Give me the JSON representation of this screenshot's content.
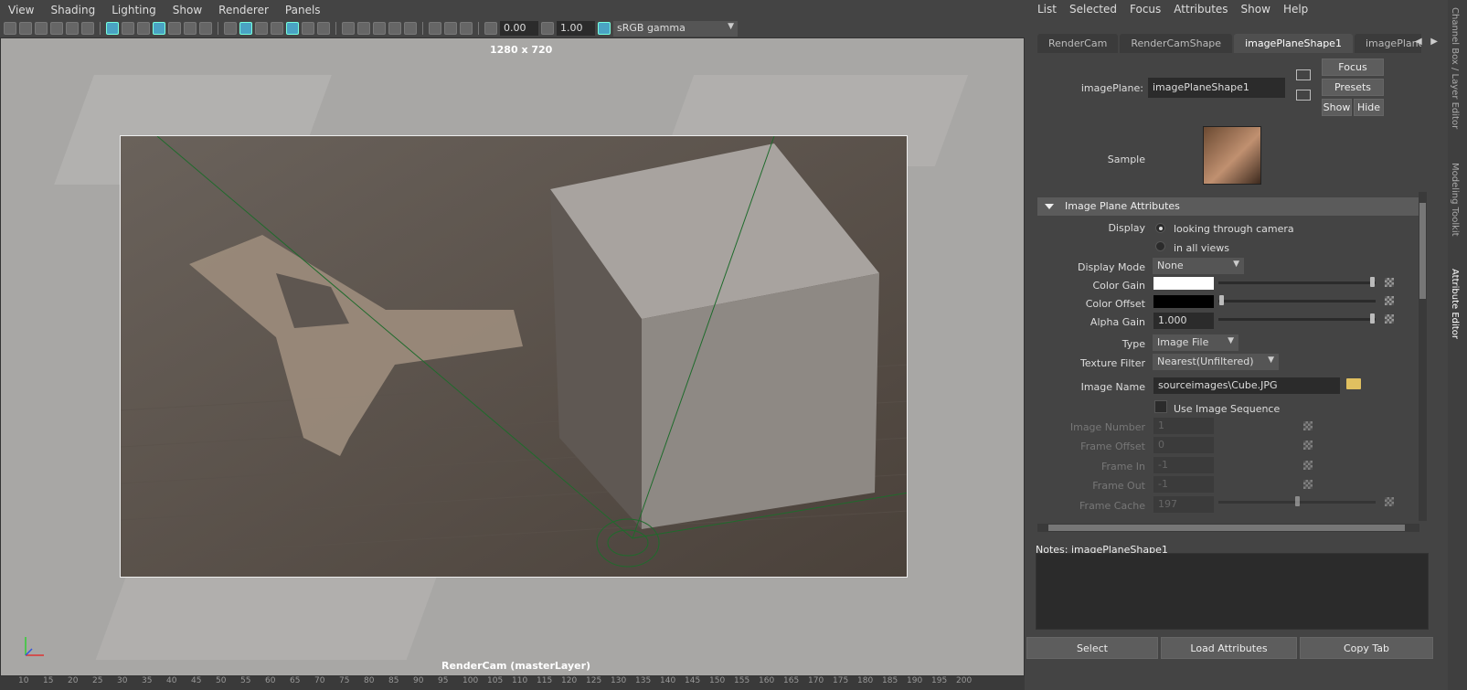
{
  "viewport": {
    "menu": [
      "View",
      "Shading",
      "Lighting",
      "Show",
      "Renderer",
      "Panels"
    ],
    "exposure": "0.00",
    "gamma": "1.00",
    "color_space": "sRGB gamma",
    "resolution_label": "1280 x 720",
    "camera_label": "RenderCam (masterLayer)"
  },
  "timeline": {
    "ticks": [
      "10",
      "15",
      "20",
      "25",
      "30",
      "35",
      "40",
      "45",
      "50",
      "55",
      "60",
      "65",
      "70",
      "75",
      "80",
      "85",
      "90",
      "95",
      "100",
      "105",
      "110",
      "115",
      "120",
      "125",
      "130",
      "135",
      "140",
      "145",
      "150",
      "155",
      "160",
      "165",
      "170",
      "175",
      "180",
      "185",
      "190",
      "195",
      "200"
    ]
  },
  "attribute_editor": {
    "menu": [
      "List",
      "Selected",
      "Focus",
      "Attributes",
      "Show",
      "Help"
    ],
    "tabs": [
      "RenderCam",
      "RenderCamShape",
      "imagePlaneShape1",
      "imagePlane"
    ],
    "node_label": "imagePlane:",
    "node_value": "imagePlaneShape1",
    "focus_btn": "Focus",
    "presets_btn": "Presets",
    "show_btn": "Show",
    "hide_btn": "Hide",
    "sample_label": "Sample",
    "section_title": "Image Plane Attributes",
    "display_label": "Display",
    "display_opt1": "looking through camera",
    "display_opt2": "in all views",
    "display_mode_label": "Display Mode",
    "display_mode_value": "None",
    "color_gain_label": "Color Gain",
    "color_offset_label": "Color Offset",
    "alpha_gain_label": "Alpha Gain",
    "alpha_gain_value": "1.000",
    "type_label": "Type",
    "type_value": "Image File",
    "texture_filter_label": "Texture Filter",
    "texture_filter_value": "Nearest(Unfiltered)",
    "image_name_label": "Image Name",
    "image_name_value": "sourceimages\\Cube.JPG",
    "use_seq_label": "Use Image Sequence",
    "image_number_label": "Image Number",
    "image_number_value": "1",
    "frame_offset_label": "Frame Offset",
    "frame_offset_value": "0",
    "frame_in_label": "Frame In",
    "frame_in_value": "-1",
    "frame_out_label": "Frame Out",
    "frame_out_value": "-1",
    "frame_cache_label": "Frame Cache",
    "frame_cache_value": "197",
    "notes_label": "Notes:  imagePlaneShape1",
    "select_btn": "Select",
    "load_btn": "Load Attributes",
    "copy_btn": "Copy Tab"
  },
  "side_tabs": [
    "Channel Box / Layer Editor",
    "Modeling Toolkit",
    "Attribute Editor"
  ]
}
